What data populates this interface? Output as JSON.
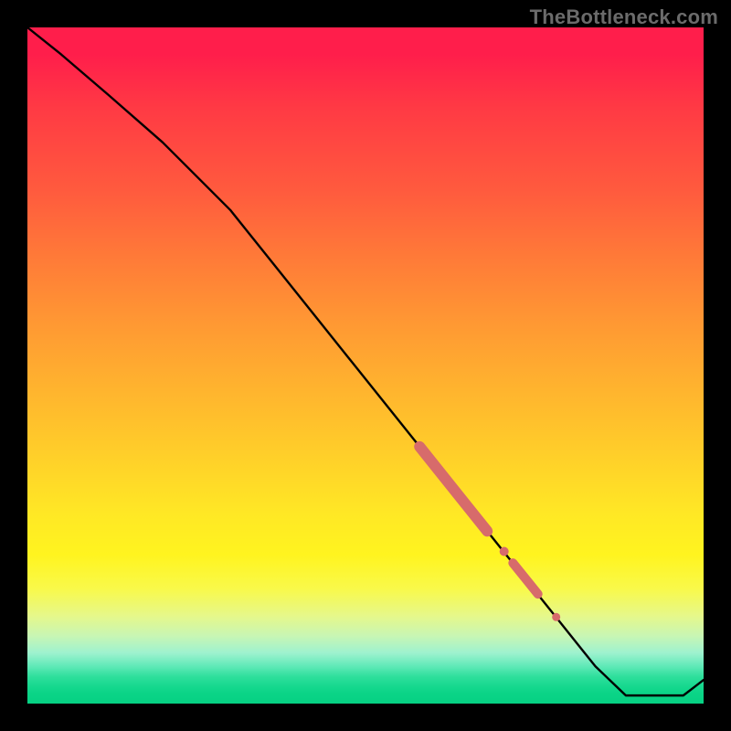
{
  "watermark": "TheBottleneck.com",
  "colors": {
    "line": "#000000",
    "marker": "#d76b6b",
    "frame": "#000000"
  },
  "chart_data": {
    "type": "line",
    "title": "",
    "xlabel": "",
    "ylabel": "",
    "xlim": [
      0,
      100
    ],
    "ylim": [
      0,
      100
    ],
    "grid": false,
    "legend": false,
    "series": [
      {
        "name": "bottleneck-curve",
        "x": [
          0,
          5,
          12,
          20,
          26,
          30,
          36,
          42,
          48,
          54,
          60,
          66,
          72,
          78,
          84,
          88.5,
          92,
          97,
          100
        ],
        "y": [
          100,
          96,
          90,
          83,
          77,
          73,
          65.5,
          58,
          50.5,
          43,
          35.5,
          28,
          20.5,
          13,
          5.5,
          1.2,
          1.2,
          1.2,
          3.5
        ]
      }
    ],
    "markers": [
      {
        "name": "highlight-segment-1",
        "shape": "segment",
        "x0": 58,
        "y0": 38,
        "x1": 68,
        "y1": 25.5,
        "width": 12
      },
      {
        "name": "highlight-dot-1",
        "shape": "dot",
        "x": 70.5,
        "y": 22.5,
        "r": 5
      },
      {
        "name": "highlight-segment-2",
        "shape": "segment",
        "x0": 71.8,
        "y0": 20.8,
        "x1": 75.5,
        "y1": 16.2,
        "width": 10
      },
      {
        "name": "highlight-dot-2",
        "shape": "dot",
        "x": 78.2,
        "y": 12.8,
        "r": 4.5
      }
    ]
  }
}
